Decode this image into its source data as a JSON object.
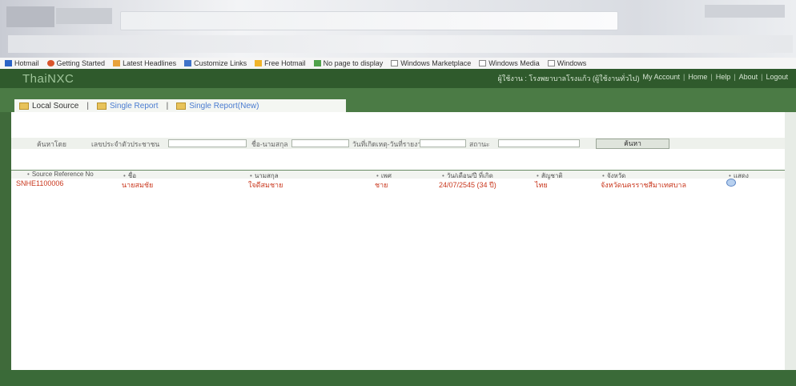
{
  "favorites": [
    {
      "label": "Hotmail",
      "icon": "hotmail-icon"
    },
    {
      "label": "Getting Started",
      "icon": "firefox-icon"
    },
    {
      "label": "Latest Headlines",
      "icon": "rss-icon"
    },
    {
      "label": "Customize Links",
      "icon": "link-icon"
    },
    {
      "label": "Free Hotmail",
      "icon": "msn-icon"
    },
    {
      "label": "No page to display",
      "icon": "page-icon"
    },
    {
      "label": "Windows Marketplace",
      "icon": "page-icon"
    },
    {
      "label": "Windows Media",
      "icon": "page-icon"
    },
    {
      "label": "Windows",
      "icon": "page-icon"
    }
  ],
  "header": {
    "logo": "ThaiNXC",
    "user_text": "ผู้ใช้งาน : โรงพยาบาลโรงแก้ว (ผู้ใช้งานทั่วไป)",
    "nav": [
      "My Account",
      "Home",
      "Help",
      "About",
      "Logout"
    ]
  },
  "tabs": [
    {
      "label": "Local Source"
    },
    {
      "label": "Single Report"
    },
    {
      "label": "Single Report(New)"
    }
  ],
  "search": {
    "field1_label": "ค้นหาโดย",
    "field2_label": "เลขประจำตัวประชาชน",
    "field3_label": "ชื่อ-นามสกุล",
    "field4_label": "วันที่เกิดเหตุ-วันที่รายงาน",
    "field5_label": "สถานะ",
    "button_label": "ค้นหา"
  },
  "table": {
    "headers": [
      "Source Reference No",
      "ชื่อ",
      "นามสกุล",
      "เพศ",
      "วัน/เดือน/ปี ที่เกิด",
      "สัญชาติ",
      "จังหวัด",
      "แสดง"
    ],
    "rows": [
      {
        "ref": "SNHE1100006",
        "first": "นายสมชัย",
        "last": "ใจดีสมชาย",
        "sex": "ชาย",
        "date": "24/07/2545 (34 ปี)",
        "nation": "ไทย",
        "province": "จังหวัดนครราชสีมาเทศบาล",
        "view_icon": "view-icon"
      }
    ]
  },
  "colors": {
    "header_green": "#2f5a2c",
    "band_green": "#4b7b45",
    "row_text_red": "#c9371d",
    "link_blue": "#4a7bd0"
  }
}
